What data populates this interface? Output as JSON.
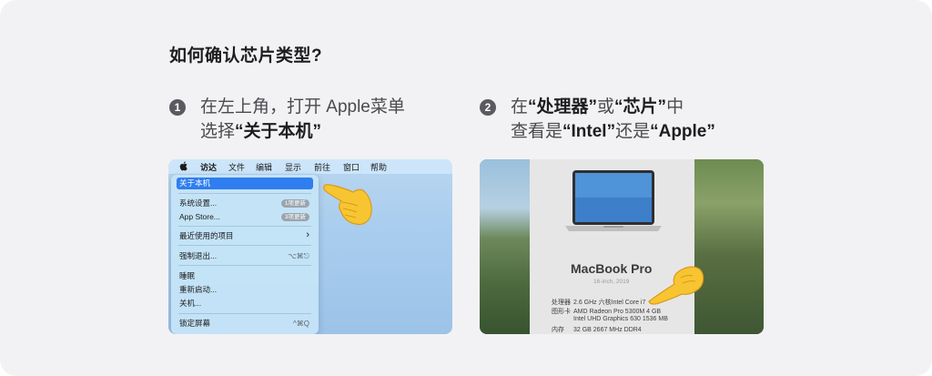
{
  "heading": "如何确认芯片类型?",
  "step1": {
    "number": "1",
    "line1": "在左上角，打开 Apple菜单",
    "line2_prefix": "选择",
    "line2_bold": "“关于本机”"
  },
  "step2": {
    "number": "2",
    "line1_prefix": "在",
    "line1_bold1": "“处理器”",
    "line1_mid": "或",
    "line1_bold2": "“芯片”",
    "line1_suffix": "中",
    "line2_prefix": "查看是",
    "line2_bold1": "“Intel”",
    "line2_mid": "还是",
    "line2_bold2": "“Apple”"
  },
  "mac_menubar": {
    "items": [
      "访达",
      "文件",
      "编辑",
      "显示",
      "前往",
      "窗口",
      "帮助"
    ]
  },
  "apple_menu": {
    "about": "关于本机",
    "settings": "系统设置...",
    "settings_badge": "1项更新",
    "appstore": "App Store...",
    "appstore_badge": "3项更新",
    "recent": "最近使用的项目",
    "recent_arrow": "›",
    "force_quit": "强制退出...",
    "force_quit_shortcut": "⌥⌘⎋",
    "sleep": "睡眠",
    "restart": "重新启动...",
    "shutdown": "关机...",
    "lock": "锁定屏幕",
    "lock_shortcut": "^⌘Q"
  },
  "about_mac": {
    "model": "MacBook Pro",
    "model_sub": "16-inch, 2019",
    "specs": [
      {
        "key": "处理器",
        "value": "2.6 GHz 六核Intel Core i7"
      },
      {
        "key": "图形卡",
        "value": "AMD Radeon Pro 5300M 4 GB"
      },
      {
        "key": "",
        "value": "Intel UHD Graphics 630 1536 MB"
      },
      {
        "key": "内存",
        "value": "32 GB 2667 MHz DDR4"
      }
    ]
  },
  "icons": [
    "apple-logo-icon",
    "pointing-hand-icon",
    "laptop-icon"
  ],
  "colors": {
    "card_bg": "#f2f2f4",
    "menu_highlight": "#2f7ef0",
    "number_badge": "#5a5a60"
  }
}
